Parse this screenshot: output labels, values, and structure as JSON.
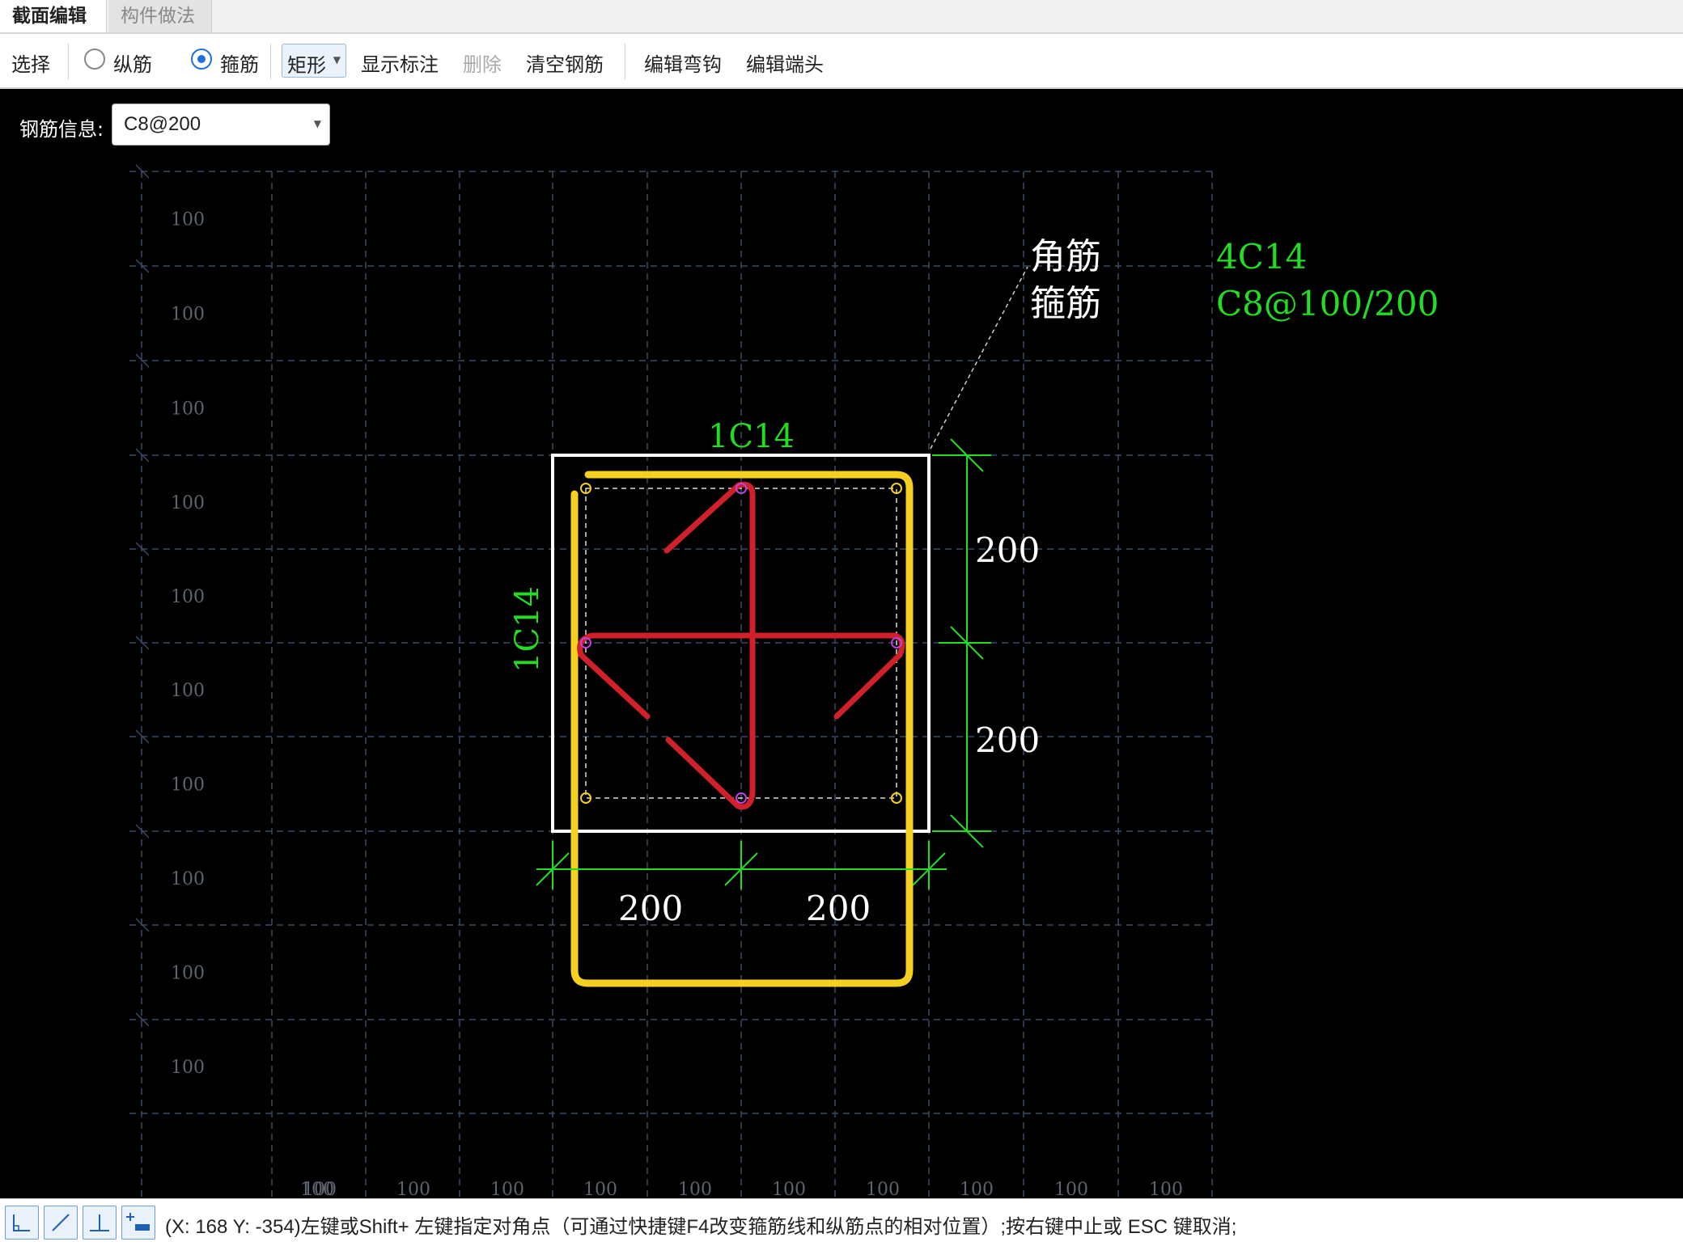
{
  "tabs": [
    {
      "label": "截面编辑",
      "active": true
    },
    {
      "label": "构件做法",
      "active": false
    }
  ],
  "toolbar": {
    "select_label": "选择",
    "radio_longitudinal_label": "纵筋",
    "radio_stirrup_label": "箍筋",
    "selected_radio": "箍筋",
    "shape_dropdown_label": "矩形",
    "show_annotation_label": "显示标注",
    "delete_label": "删除",
    "clear_rebar_label": "清空钢筋",
    "edit_hook_label": "编辑弯钩",
    "edit_end_label": "编辑端头"
  },
  "rebar_info": {
    "label": "钢筋信息:",
    "value": "C8@200"
  },
  "drawing": {
    "grid_row_label": "100",
    "grid_col_label": "100",
    "top_rebar_label": "1C14",
    "side_rebar_label": "1C14",
    "legend_corner_label": "角筋",
    "legend_stirrup_label": "箍筋",
    "legend_corner_value": "4C14",
    "legend_stirrup_value": "C8@100/200",
    "dim_right_top": "200",
    "dim_right_bottom": "200",
    "dim_bottom_left": "200",
    "dim_bottom_right": "200",
    "colors": {
      "background": "#000000",
      "grid": "#3a4a66",
      "section": "#ffffff",
      "stirrup_main": "#f5d020",
      "stirrup_inner": "#d0202a",
      "dimension": "#22dd22",
      "annotation": "#22dd22"
    }
  },
  "statusbar": {
    "buttons": [
      "orthogonal-icon",
      "line-icon",
      "perpendicular-icon",
      "add-point-icon"
    ],
    "message": "(X: 168 Y: -354)左键或Shift+ 左键指定对角点（可通过快捷键F4改变箍筋线和纵筋点的相对位置）;按右键中止或 ESC 键取消;"
  }
}
